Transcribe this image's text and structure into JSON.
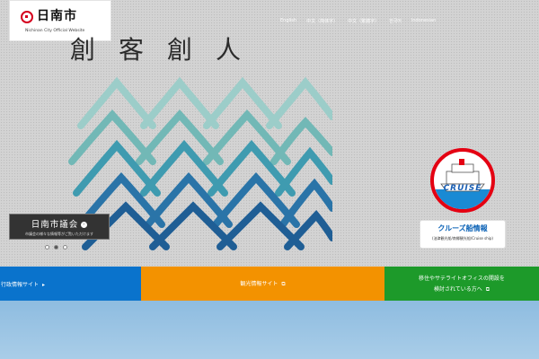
{
  "header": {
    "logo_name": "日南市",
    "logo_sub": "Nichinan City Official Website",
    "nav": [
      "English",
      "中文（简体字）",
      "中文（繁體字）",
      "한국어",
      "Indonesian"
    ]
  },
  "hero": {
    "catchphrase": "創客創人",
    "gikai": {
      "title": "日南市議会",
      "arrow": "›",
      "subtitle": "市議会の様々な情報等がご覧いただけます"
    },
    "slide_count": 3,
    "active_slide": 2,
    "cruise": {
      "ship_text": "CRUISE",
      "title": "クルーズ船情報",
      "subtitle": "(油津観光船/南郷観光船/Cruise ship)"
    }
  },
  "links": [
    {
      "label": "行政情報サイト",
      "arrow": "▸",
      "color": "#0a73cc"
    },
    {
      "label": "観光情報サイト",
      "arrow": "⧉",
      "color": "#f39200"
    },
    {
      "label_line1": "移住やサテライトオフィスの開設を",
      "label_line2": "検討されている方へ",
      "arrow": "⧉",
      "color": "#1d9a2a"
    }
  ],
  "colors": {
    "wave_dark": "#1f5e95",
    "wave_mid": "#2d86a8",
    "wave_light": "#8ec6c4",
    "accent_red": "#d4001e"
  }
}
